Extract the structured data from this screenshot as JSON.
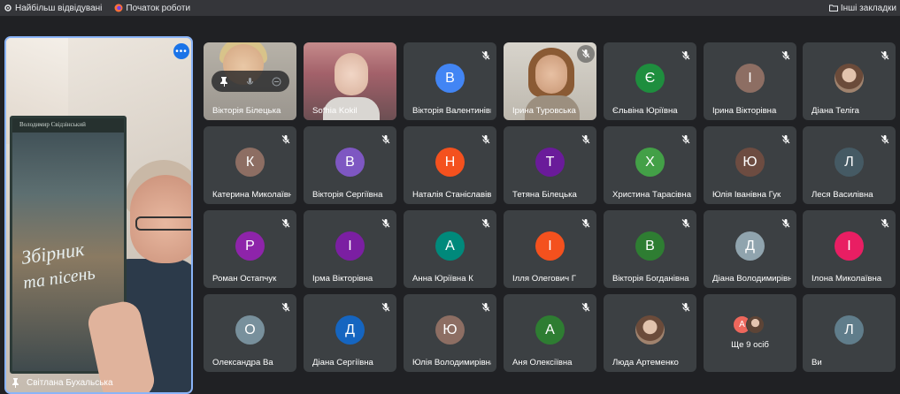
{
  "bookmarks": {
    "left": [
      {
        "label": "Найбільш відвідувані",
        "icon": "gear-icon"
      },
      {
        "label": "Початок роботи",
        "icon": "firefox-icon"
      }
    ],
    "right": {
      "label": "Інші закладки",
      "icon": "folder-icon"
    }
  },
  "pinned": {
    "name": "Світлана Бухальська",
    "book_author": "Володимир Свідзінський",
    "book_title_line1": "Збірник",
    "book_title_line2": "та пісень"
  },
  "tiles": [
    {
      "name": "Вікторія Білецька",
      "type": "video",
      "video": "v1",
      "controls": true
    },
    {
      "name": "Sofhia Kokil",
      "type": "video",
      "video": "v2"
    },
    {
      "name": "Вікторія Валентинівна",
      "initial": "В",
      "color": "#4285f4"
    },
    {
      "name": "Ірина Туровська",
      "type": "video",
      "video": "v3",
      "muted_badge": true
    },
    {
      "name": "Єльвіна Юріївна",
      "initial": "Є",
      "color": "#1e8e3e"
    },
    {
      "name": "Ірина Вікторівна",
      "initial": "І",
      "color": "#8d6e63"
    },
    {
      "name": "Діана Теліга",
      "type": "photo"
    },
    {
      "name": "Катерина Миколаївна",
      "initial": "К",
      "color": "#8d6e63"
    },
    {
      "name": "Вікторія Сергіївна",
      "initial": "В",
      "color": "#7e57c2"
    },
    {
      "name": "Наталія Станіславівна",
      "initial": "Н",
      "color": "#f4511e"
    },
    {
      "name": "Тетяна Білецька",
      "initial": "Т",
      "color": "#6a1b9a"
    },
    {
      "name": "Христина Тарасівна",
      "initial": "Х",
      "color": "#43a047"
    },
    {
      "name": "Юлія Іванівна Гук",
      "initial": "Ю",
      "color": "#6d4c41"
    },
    {
      "name": "Леся Василівна",
      "initial": "Л",
      "color": "#455a64"
    },
    {
      "name": "Роман Остапчук",
      "initial": "Р",
      "color": "#8e24aa"
    },
    {
      "name": "Ірма Вікторівна",
      "initial": "І",
      "color": "#7b1fa2"
    },
    {
      "name": "Анна Юріївна К",
      "initial": "А",
      "color": "#00897b"
    },
    {
      "name": "Ілля Олегович Г",
      "initial": "І",
      "color": "#f4511e"
    },
    {
      "name": "Вікторія Богданівна",
      "initial": "В",
      "color": "#2e7d32"
    },
    {
      "name": "Діана Володимирівна",
      "initial": "Д",
      "color": "#90a4ae"
    },
    {
      "name": "Ілона Миколаївна",
      "initial": "І",
      "color": "#e91e63"
    },
    {
      "name": "Олександра Ва",
      "initial": "О",
      "color": "#78909c"
    },
    {
      "name": "Діана Сергіївна",
      "initial": "Д",
      "color": "#1565c0"
    },
    {
      "name": "Юлія Володимирівна",
      "initial": "Ю",
      "color": "#8d6e63"
    },
    {
      "name": "Аня Олексіївна",
      "initial": "А",
      "color": "#2e7d32"
    },
    {
      "name": "Люда Артеменко",
      "type": "photo"
    },
    {
      "name": "Ще 9 осіб",
      "type": "more",
      "initial": "А"
    },
    {
      "name": "Ви",
      "initial": "Л",
      "color": "#607d8b",
      "nomute": true
    }
  ]
}
